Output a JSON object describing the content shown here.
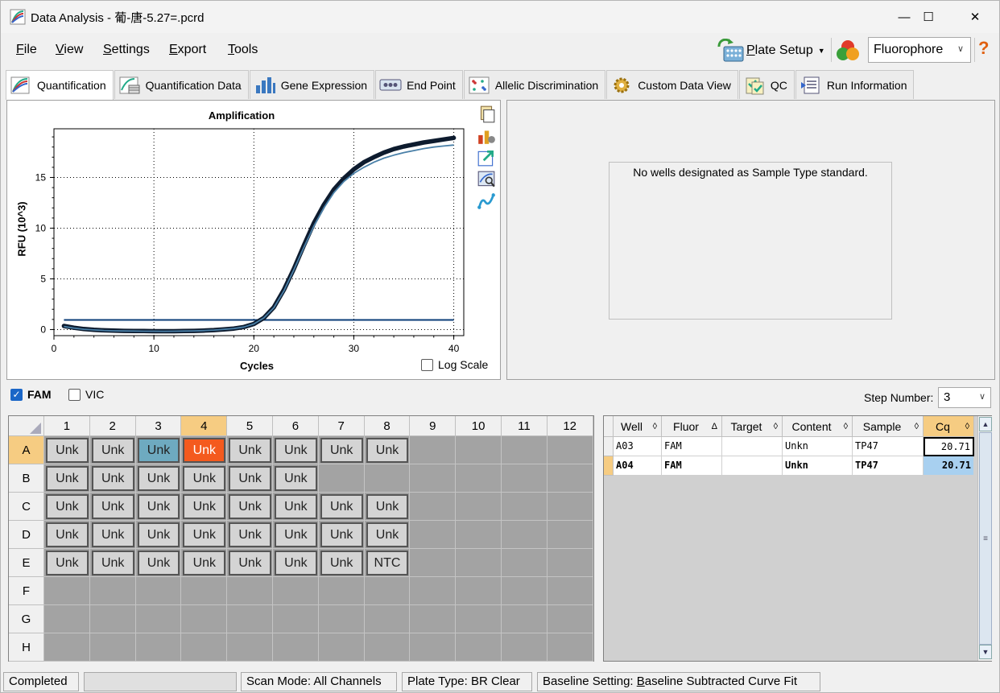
{
  "window": {
    "title": "Data Analysis - 葡-唐-5.27=.pcrd",
    "min_glyph": "—",
    "max_glyph": "☐",
    "close_glyph": "✕"
  },
  "menu": {
    "items": [
      {
        "label_u": "F",
        "label_rest": "ile"
      },
      {
        "label_u": "V",
        "label_rest": "iew"
      },
      {
        "label_u": "S",
        "label_rest": "ettings"
      },
      {
        "label_u": "E",
        "label_rest": "xport"
      },
      {
        "label_u": "T",
        "label_rest": "ools"
      }
    ],
    "plate_setup_u": "P",
    "plate_setup_rest": "late Setup",
    "fluorophore_value": "Fluorophore",
    "help_glyph": "?"
  },
  "tabs": [
    {
      "label": "Quantification",
      "active": true
    },
    {
      "label": "Quantification Data"
    },
    {
      "label": "Gene Expression"
    },
    {
      "label": "End Point"
    },
    {
      "label": "Allelic Discrimination"
    },
    {
      "label": "Custom Data View"
    },
    {
      "label": "QC"
    },
    {
      "label": "Run Information"
    }
  ],
  "chart_data": {
    "type": "line",
    "title": "Amplification",
    "xlabel": "Cycles",
    "ylabel": "RFU (10^3)",
    "xlim": [
      0,
      41
    ],
    "ylim": [
      -0.6,
      19.8
    ],
    "xticks": [
      0,
      10,
      20,
      30,
      40
    ],
    "yticks": [
      0,
      5,
      10,
      15
    ],
    "grid": true,
    "threshold": 0.95,
    "series": [
      {
        "well": "A04",
        "x": [
          1,
          2,
          3,
          4,
          5,
          6,
          7,
          8,
          9,
          10,
          11,
          12,
          13,
          14,
          15,
          16,
          17,
          18,
          19,
          20,
          21,
          22,
          23,
          24,
          25,
          26,
          27,
          28,
          29,
          30,
          31,
          32,
          33,
          34,
          35,
          36,
          37,
          38,
          39,
          40
        ],
        "y": [
          0.35,
          0.18,
          0.05,
          -0.03,
          -0.08,
          -0.11,
          -0.13,
          -0.14,
          -0.15,
          -0.16,
          -0.16,
          -0.16,
          -0.15,
          -0.13,
          -0.1,
          -0.05,
          0.02,
          0.1,
          0.25,
          0.55,
          1.15,
          2.2,
          3.9,
          6.0,
          8.3,
          10.5,
          12.3,
          13.8,
          14.9,
          15.8,
          16.5,
          17.0,
          17.45,
          17.8,
          18.05,
          18.25,
          18.45,
          18.6,
          18.75,
          18.9
        ],
        "color": "#0d1b2e"
      },
      {
        "well": "A03",
        "x": [
          1,
          2,
          3,
          4,
          5,
          6,
          7,
          8,
          9,
          10,
          11,
          12,
          13,
          14,
          15,
          16,
          17,
          18,
          19,
          20,
          21,
          22,
          23,
          24,
          25,
          26,
          27,
          28,
          29,
          30,
          31,
          32,
          33,
          34,
          35,
          36,
          37,
          38,
          39,
          40
        ],
        "y": [
          0.3,
          0.15,
          0.03,
          -0.04,
          -0.09,
          -0.12,
          -0.14,
          -0.15,
          -0.16,
          -0.16,
          -0.17,
          -0.16,
          -0.15,
          -0.13,
          -0.1,
          -0.05,
          0.02,
          0.1,
          0.25,
          0.55,
          1.15,
          2.15,
          3.8,
          5.9,
          8.1,
          10.2,
          12.0,
          13.5,
          14.6,
          15.4,
          16.0,
          16.5,
          16.9,
          17.2,
          17.45,
          17.65,
          17.85,
          18.0,
          18.1,
          18.2
        ],
        "color": "#4a80a8"
      }
    ]
  },
  "log_scale_label": "Log Scale",
  "std_message": "No wells designated as Sample Type standard.",
  "fluor_toggles": [
    {
      "label": "FAM",
      "checked": true
    },
    {
      "label": "VIC",
      "checked": false
    }
  ],
  "step_number": {
    "label": "Step Number:",
    "value": "3"
  },
  "plate": {
    "columns": [
      "1",
      "2",
      "3",
      "4",
      "5",
      "6",
      "7",
      "8",
      "9",
      "10",
      "11",
      "12"
    ],
    "rows": [
      "A",
      "B",
      "C",
      "D",
      "E",
      "F",
      "G",
      "H"
    ],
    "highlight_row": "A",
    "highlight_col": "4",
    "wells": [
      [
        "Unk",
        "Unk",
        "Unk",
        "Unk",
        "Unk",
        "Unk",
        "Unk",
        "Unk",
        "",
        "",
        "",
        ""
      ],
      [
        "Unk",
        "Unk",
        "Unk",
        "Unk",
        "Unk",
        "Unk",
        "",
        "",
        "",
        "",
        "",
        ""
      ],
      [
        "Unk",
        "Unk",
        "Unk",
        "Unk",
        "Unk",
        "Unk",
        "Unk",
        "Unk",
        "",
        "",
        "",
        ""
      ],
      [
        "Unk",
        "Unk",
        "Unk",
        "Unk",
        "Unk",
        "Unk",
        "Unk",
        "Unk",
        "",
        "",
        "",
        ""
      ],
      [
        "Unk",
        "Unk",
        "Unk",
        "Unk",
        "Unk",
        "Unk",
        "Unk",
        "NTC",
        "",
        "",
        "",
        ""
      ],
      [
        "",
        "",
        "",
        "",
        "",
        "",
        "",
        "",
        "",
        "",
        "",
        ""
      ],
      [
        "",
        "",
        "",
        "",
        "",
        "",
        "",
        "",
        "",
        "",
        "",
        ""
      ],
      [
        "",
        "",
        "",
        "",
        "",
        "",
        "",
        "",
        "",
        "",
        "",
        ""
      ]
    ],
    "selected_blue": "A3",
    "selected_orange": "A4"
  },
  "table": {
    "columns": [
      {
        "label": "Well",
        "sort": "◊"
      },
      {
        "label": "Fluor",
        "sort": "Δ"
      },
      {
        "label": "Target",
        "sort": "◊"
      },
      {
        "label": "Content",
        "sort": "◊"
      },
      {
        "label": "Sample",
        "sort": "◊"
      },
      {
        "label": "Cq",
        "sort": "◊"
      }
    ],
    "rows": [
      [
        "A03",
        "FAM",
        "",
        "Unkn",
        "TP47",
        "20.71"
      ],
      [
        "A04",
        "FAM",
        "",
        "Unkn",
        "TP47",
        "20.71"
      ]
    ]
  },
  "status": {
    "state": "Completed",
    "scan_mode": "Scan Mode: All Channels",
    "plate_type": "Plate Type: BR Clear",
    "baseline_pre": "Baseline Setting: ",
    "baseline_u": "B",
    "baseline_rest": "aseline Subtracted Curve Fit"
  }
}
